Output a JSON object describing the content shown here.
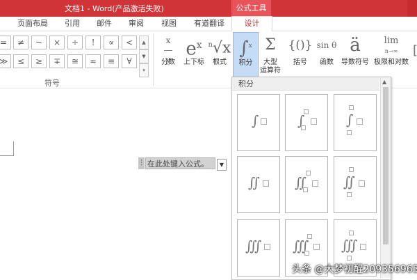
{
  "titlebar": {
    "title": "文档1 - Word(产品激活失败)",
    "context_group": "公式工具",
    "color": "#d13438"
  },
  "tabs": [
    {
      "label": "页面布局"
    },
    {
      "label": "引用"
    },
    {
      "label": "邮件"
    },
    {
      "label": "审阅"
    },
    {
      "label": "视图"
    },
    {
      "label": "有道翻译"
    },
    {
      "label": "设计",
      "active": true
    }
  ],
  "symbols": {
    "row1": [
      "=",
      "≠",
      "~",
      "×",
      "÷",
      "!",
      "∝",
      "<"
    ],
    "row2": [
      "≫",
      "≤",
      "≥",
      "∓",
      "≅",
      "≈",
      "≡",
      "∀"
    ],
    "group_label": "符号"
  },
  "structures": [
    {
      "icon": "x/y",
      "label": "分数"
    },
    {
      "icon": "eˣ",
      "label": "上下标"
    },
    {
      "icon": "ⁿ√x",
      "label": "根式"
    },
    {
      "icon": "∫",
      "label": "积分"
    },
    {
      "icon": "Σ",
      "label": "大型\n运算符"
    },
    {
      "icon": "{()}",
      "label": "括号"
    },
    {
      "icon": "sin θ",
      "label": "函数"
    },
    {
      "icon": "ä",
      "label": "导数符号"
    },
    {
      "icon": "lim",
      "label": "极限和对数"
    }
  ],
  "document": {
    "equation_placeholder": "在此处键入公式。"
  },
  "gallery": {
    "header": "积分"
  },
  "watermark": "头条 @大梦初醒209356965"
}
